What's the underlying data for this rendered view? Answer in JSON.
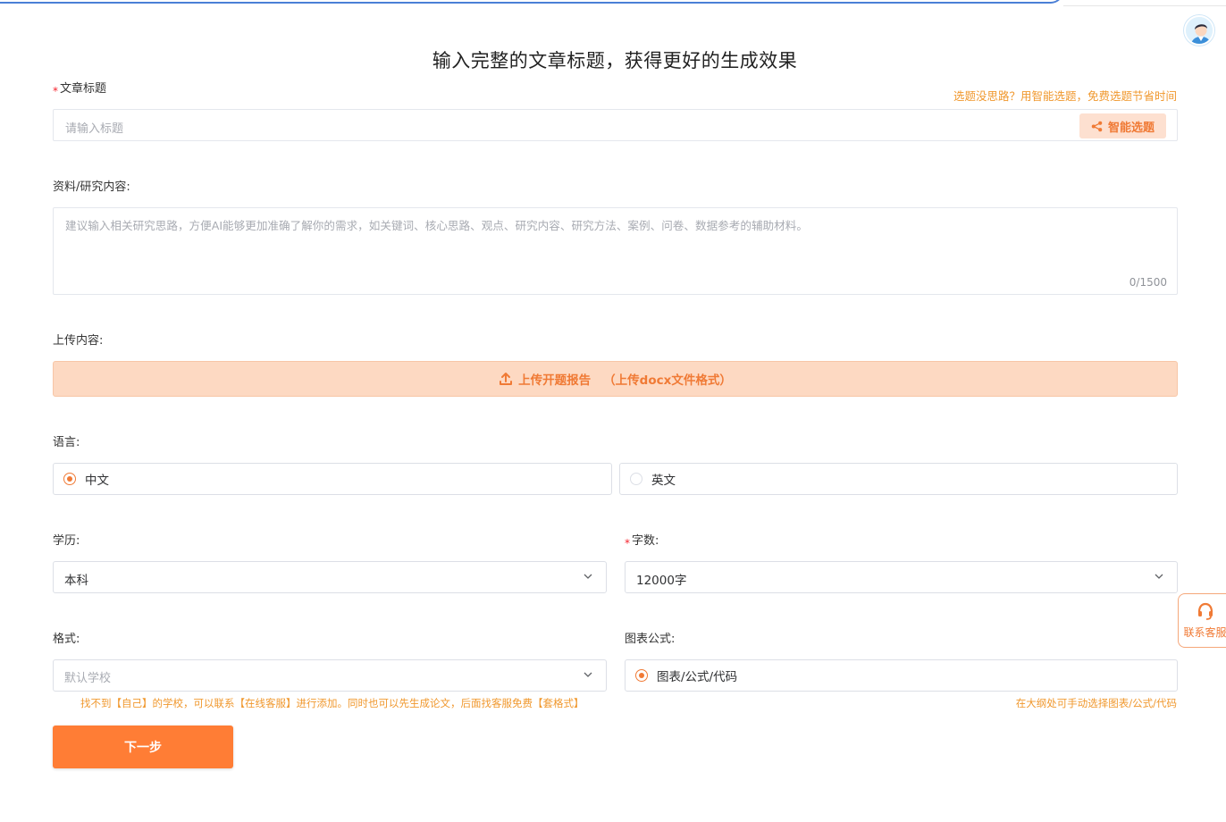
{
  "header": {
    "title": "输入完整的文章标题，获得更好的生成效果"
  },
  "title_field": {
    "required_mark": "*",
    "label": "文章标题",
    "hint": "选题没思路？用智能选题，免费选题节省时间",
    "placeholder": "请输入标题",
    "smart_button": "智能选题"
  },
  "content_field": {
    "label": "资料/研究内容:",
    "placeholder": "建议输入相关研究思路，方便AI能够更加准确了解你的需求，如关键词、核心思路、观点、研究内容、研究方法、案例、问卷、数据参考的辅助材料。",
    "counter": "0/1500"
  },
  "upload": {
    "label": "上传内容:",
    "button": "上传开题报告",
    "note": "（上传docx文件格式）"
  },
  "language": {
    "label": "语言:",
    "options": [
      {
        "label": "中文",
        "selected": true
      },
      {
        "label": "英文",
        "selected": false
      }
    ]
  },
  "education": {
    "label": "学历:",
    "value": "本科"
  },
  "word_count": {
    "required_mark": "*",
    "label": "字数:",
    "value": "12000字"
  },
  "format": {
    "label": "格式:",
    "placeholder": "默认学校",
    "note": "找不到【自己】的学校，可以联系【在线客服】进行添加。同时也可以先生成论文，后面找客服免费【套格式】"
  },
  "charts": {
    "label": "图表公式:",
    "option": "图表/公式/代码",
    "selected": true,
    "note": "在大纲处可手动选择图表/公式/代码"
  },
  "next_button": "下一步",
  "service": {
    "label": "联系客服",
    "icon": "headset-icon"
  },
  "colors": {
    "accent": "#ff7d35",
    "accent_light": "#fdd9c2",
    "hint": "#f0982e",
    "required": "#f5222d"
  }
}
